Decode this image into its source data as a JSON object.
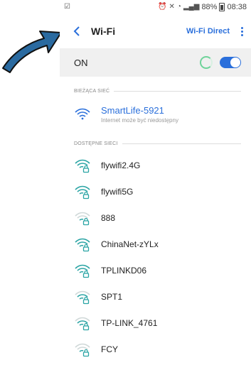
{
  "status": {
    "battery": "88%",
    "time": "08:38"
  },
  "appbar": {
    "title": "Wi-Fi",
    "wifi_direct": "Wi-Fi Direct"
  },
  "toggle_row": {
    "label": "ON"
  },
  "current": {
    "section_label": "BIEŻĄCA SIEĆ",
    "name": "SmartLife-5921",
    "subtitle": "Internet może być niedostępny"
  },
  "available": {
    "section_label": "DOSTĘPNE SIECI",
    "networks": [
      {
        "name": "flywifi2.4G",
        "signal": "strong"
      },
      {
        "name": "flywifi5G",
        "signal": "strong"
      },
      {
        "name": "888",
        "signal": "weak"
      },
      {
        "name": "ChinaNet-zYLx",
        "signal": "strong"
      },
      {
        "name": "TPLINKD06",
        "signal": "strong"
      },
      {
        "name": "SPT1",
        "signal": "medium"
      },
      {
        "name": "TP-LINK_4761",
        "signal": "medium"
      },
      {
        "name": "FCY",
        "signal": "weak"
      }
    ]
  },
  "colors": {
    "accent": "#2a6fdb",
    "arrow": "#2a6aa0",
    "lock_icon": "#2aa4a4"
  }
}
